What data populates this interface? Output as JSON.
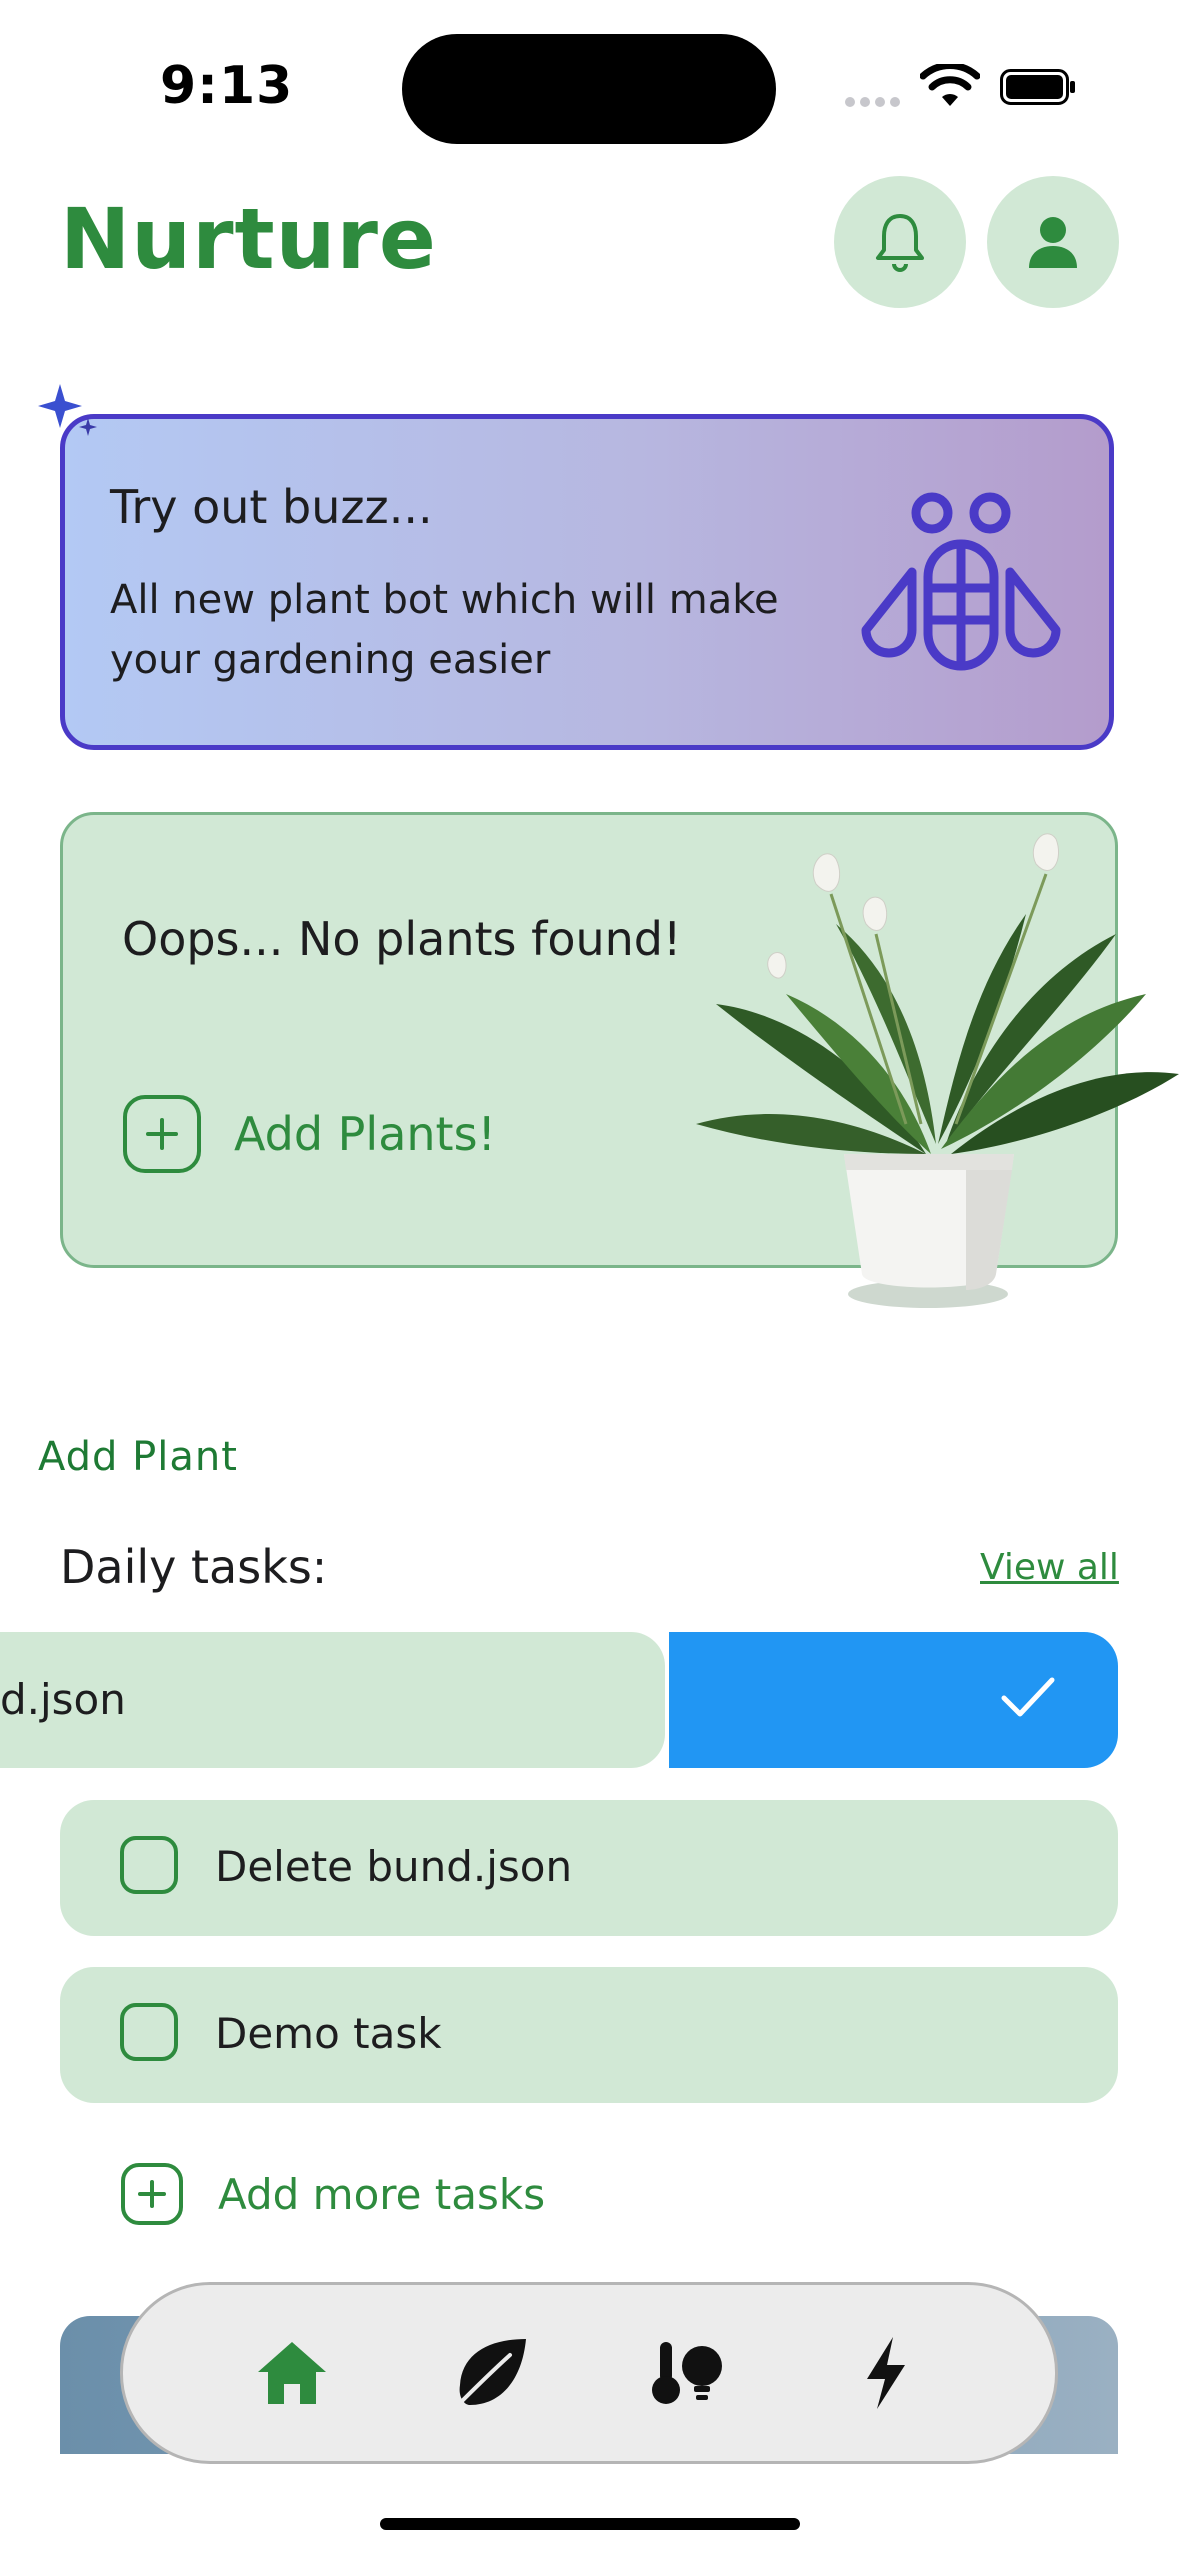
{
  "status_bar": {
    "time": "9:13"
  },
  "header": {
    "title": "Nurture",
    "icons": {
      "notifications": "bell-icon",
      "profile": "person-icon"
    }
  },
  "buzz_card": {
    "title": "Try out buzz...",
    "description": "All new plant bot which will make your gardening easier",
    "icon": "bee-icon"
  },
  "plants_card": {
    "empty_message": "Oops... No plants found!",
    "add_label": "Add Plants!"
  },
  "add_plant_link": "Add Plant",
  "tasks": {
    "title": "Daily tasks:",
    "view_all": "View all",
    "swiped_item_text": "d.json",
    "items": [
      {
        "label": "Delete bund.json",
        "checked": false
      },
      {
        "label": "Demo task",
        "checked": false
      }
    ],
    "add_more": "Add more tasks"
  },
  "tab_bar": {
    "tabs": [
      {
        "name": "home",
        "icon": "home-icon",
        "active": true
      },
      {
        "name": "plants",
        "icon": "leaf-icon",
        "active": false
      },
      {
        "name": "conditions",
        "icon": "thermometer-bulb-icon",
        "active": false
      },
      {
        "name": "energy",
        "icon": "lightning-icon",
        "active": false
      }
    ]
  },
  "colors": {
    "brand_green": "#2e8b3e",
    "card_green": "#d1e8d5",
    "action_blue": "#2196f3",
    "buzz_border": "#4a3ac7"
  }
}
